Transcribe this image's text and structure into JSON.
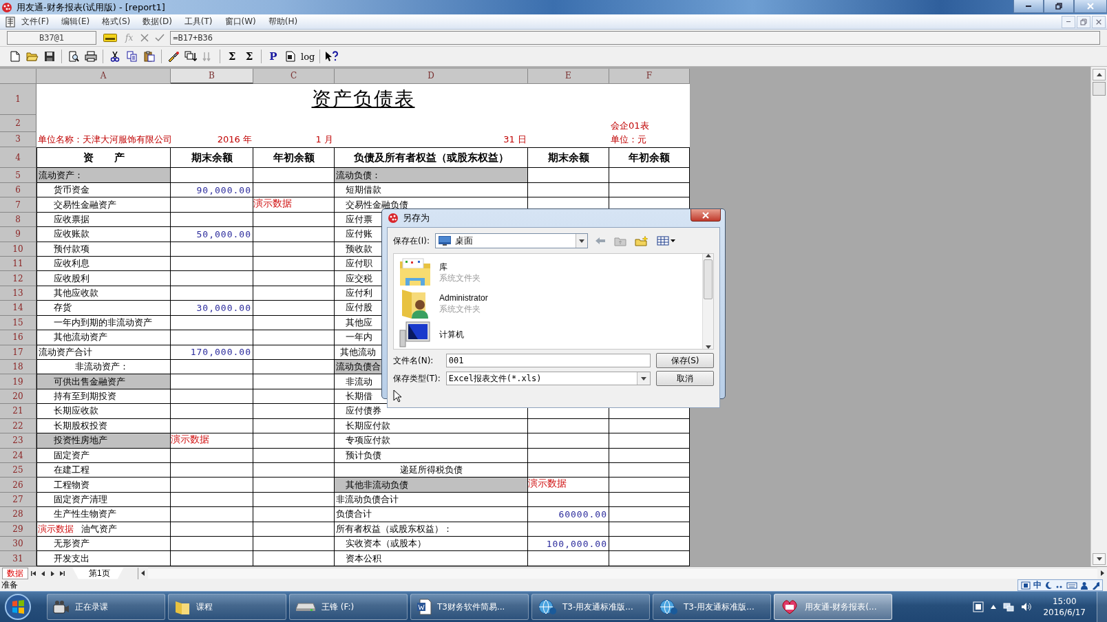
{
  "window": {
    "title": "用友通-财务报表(试用版) - [report1]"
  },
  "menu": [
    "文件(F)",
    "编辑(E)",
    "格式(S)",
    "数据(D)",
    "工具(T)",
    "窗口(W)",
    "帮助(H)"
  ],
  "formula_bar": {
    "cell_ref": "B37@1",
    "function_glyph": "fx",
    "formula": "=B17+B36"
  },
  "toolbar": {
    "glyphs": [
      "Σ",
      "Σ",
      "P",
      "log"
    ]
  },
  "sheet": {
    "columns": [
      {
        "label": "A",
        "selected": false
      },
      {
        "label": "B",
        "selected": true
      },
      {
        "label": "C",
        "selected": false
      },
      {
        "label": "D",
        "selected": false
      },
      {
        "label": "E",
        "selected": false
      },
      {
        "label": "F",
        "selected": false
      }
    ],
    "title_row": {
      "number": "1",
      "text": "资产负债表"
    },
    "code_row": {
      "number": "2",
      "text": "会企01表"
    },
    "info_row": {
      "number": "3",
      "company": "单位名称：天津大河服饰有限公司",
      "year": "2016 年",
      "month": "1 月",
      "day": "31 日",
      "unit": "单位：元"
    },
    "header_row": {
      "number": "4",
      "cells": [
        "资　　产",
        "期末余额",
        "年初余额",
        "负债及所有者权益（或股东权益）",
        "期末余额",
        "年初余额"
      ]
    },
    "rows": [
      {
        "number": "5",
        "a": {
          "text": "流动资产：",
          "kind": "heading",
          "shaded": true
        },
        "d": {
          "text": "流动负债：",
          "kind": "heading",
          "shaded": true
        }
      },
      {
        "number": "6",
        "a": {
          "text": "货币资金",
          "kind": "item",
          "shaded": false
        },
        "b": {
          "text": "90,000.00",
          "kind": "amount",
          "shaded": false
        },
        "d": {
          "text": "短期借款",
          "kind": "item",
          "shaded": false
        }
      },
      {
        "number": "7",
        "a": {
          "text": "交易性金融资产",
          "kind": "item",
          "shaded": false
        },
        "c": {
          "text": "演示数据",
          "kind": "demo",
          "shaded": false
        },
        "d": {
          "text": "交易性金融负债",
          "kind": "item",
          "shaded": false
        }
      },
      {
        "number": "8",
        "a": {
          "text": "应收票据",
          "kind": "item",
          "shaded": false
        },
        "d": {
          "text": "应付票",
          "kind": "item",
          "shaded": false
        }
      },
      {
        "number": "9",
        "a": {
          "text": "应收账款",
          "kind": "item",
          "shaded": false
        },
        "b": {
          "text": "50,000.00",
          "kind": "amount",
          "shaded": false
        },
        "d": {
          "text": "应付账",
          "kind": "item",
          "shaded": false
        }
      },
      {
        "number": "10",
        "a": {
          "text": "预付款项",
          "kind": "item",
          "shaded": false
        },
        "d": {
          "text": "预收款",
          "kind": "item",
          "shaded": false
        }
      },
      {
        "number": "11",
        "a": {
          "text": "应收利息",
          "kind": "item",
          "shaded": false
        },
        "d": {
          "text": "应付职",
          "kind": "item",
          "shaded": false
        }
      },
      {
        "number": "12",
        "a": {
          "text": "应收股利",
          "kind": "item",
          "shaded": false
        },
        "d": {
          "text": "应交税",
          "kind": "item",
          "shaded": false
        }
      },
      {
        "number": "13",
        "a": {
          "text": "其他应收款",
          "kind": "item",
          "shaded": false
        },
        "d": {
          "text": "应付利",
          "kind": "item",
          "shaded": false
        }
      },
      {
        "number": "14",
        "a": {
          "text": "存货",
          "kind": "item",
          "shaded": false
        },
        "b": {
          "text": "30,000.00",
          "kind": "amount",
          "shaded": false
        },
        "d": {
          "text": "应付股",
          "kind": "item",
          "shaded": false
        }
      },
      {
        "number": "15",
        "a": {
          "text": "一年内到期的非流动资产",
          "kind": "item",
          "shaded": false
        },
        "d": {
          "text": "其他应",
          "kind": "item",
          "shaded": false
        }
      },
      {
        "number": "16",
        "a": {
          "text": "其他流动资产",
          "kind": "item",
          "shaded": false
        },
        "d": {
          "text": "一年内",
          "kind": "item",
          "shaded": false
        }
      },
      {
        "number": "17",
        "a": {
          "text": "流动资产合计",
          "kind": "heading",
          "shaded": false
        },
        "b": {
          "text": "170,000.00",
          "kind": "amount",
          "shaded": false
        },
        "d": {
          "text": "其他流动",
          "kind": "minor",
          "shaded": false
        }
      },
      {
        "number": "18",
        "a": {
          "text": "非流动资产：",
          "kind": "sub",
          "shaded": false
        },
        "d": {
          "text": "流动负债合",
          "kind": "heading",
          "shaded": true
        }
      },
      {
        "number": "19",
        "a": {
          "text": "可供出售金融资产",
          "kind": "item",
          "shaded": true
        },
        "d": {
          "text": "非流动",
          "kind": "item",
          "shaded": false
        }
      },
      {
        "number": "20",
        "a": {
          "text": "持有至到期投资",
          "kind": "item",
          "shaded": false
        },
        "d": {
          "text": "长期借",
          "kind": "item",
          "shaded": false
        }
      },
      {
        "number": "21",
        "a": {
          "text": "长期应收款",
          "kind": "item",
          "shaded": false
        },
        "d": {
          "text": "应付债券",
          "kind": "item",
          "shaded": false
        }
      },
      {
        "number": "22",
        "a": {
          "text": "长期股权投资",
          "kind": "item",
          "shaded": false
        },
        "d": {
          "text": "长期应付款",
          "kind": "item",
          "shaded": false
        }
      },
      {
        "number": "23",
        "a": {
          "text": "投资性房地产",
          "kind": "item",
          "shaded": true
        },
        "b": {
          "text": "演示数据",
          "kind": "demo",
          "shaded": false
        },
        "d": {
          "text": "专项应付款",
          "kind": "item",
          "shaded": false
        }
      },
      {
        "number": "24",
        "a": {
          "text": "固定资产",
          "kind": "item",
          "shaded": false
        },
        "d": {
          "text": "预计负债",
          "kind": "item",
          "shaded": false
        }
      },
      {
        "number": "25",
        "a": {
          "text": "在建工程",
          "kind": "item",
          "shaded": false
        },
        "d": {
          "text": "递延所得税负债",
          "kind": "center",
          "shaded": false
        }
      },
      {
        "number": "26",
        "a": {
          "text": "工程物资",
          "kind": "item",
          "shaded": false
        },
        "d": {
          "text": "其他非流动负债",
          "kind": "item",
          "shaded": true
        },
        "e": {
          "text": "演示数据",
          "kind": "demo",
          "shaded": false
        }
      },
      {
        "number": "27",
        "a": {
          "text": "固定资产清理",
          "kind": "item",
          "shaded": false
        },
        "d": {
          "text": "非流动负债合计",
          "kind": "heading",
          "shaded": false
        }
      },
      {
        "number": "28",
        "a": {
          "text": "生产性生物资产",
          "kind": "item",
          "shaded": false
        },
        "d": {
          "text": "负债合计",
          "kind": "heading",
          "shaded": false
        },
        "e": {
          "text": "60000.00",
          "kind": "amount",
          "shaded": false
        }
      },
      {
        "number": "29",
        "a": {
          "text": "油气资产",
          "kind": "item",
          "shaded": false,
          "mark": "演示数据"
        },
        "d": {
          "text": "所有者权益（或股东权益）：",
          "kind": "heading",
          "shaded": false
        }
      },
      {
        "number": "30",
        "a": {
          "text": "无形资产",
          "kind": "item",
          "shaded": false
        },
        "d": {
          "text": "实收资本（或股本）",
          "kind": "item",
          "shaded": false
        },
        "e": {
          "text": "100,000.00",
          "kind": "amount",
          "shaded": false
        }
      },
      {
        "number": "31",
        "a": {
          "text": "开发支出",
          "kind": "item",
          "shaded": false
        },
        "d": {
          "text": "资本公积",
          "kind": "item",
          "shaded": false
        }
      }
    ]
  },
  "sheet_tabs": {
    "mode": "数据",
    "tabs": [
      {
        "label": "第1页",
        "selected": true
      }
    ]
  },
  "status_bar": {
    "text": "准备",
    "ime": "中"
  },
  "dialog": {
    "title": "另存为",
    "save_in_label": "保存在(I):",
    "save_in_value": "桌面",
    "files": [
      {
        "name": "库",
        "type": "系统文件夹",
        "kind": "library"
      },
      {
        "name": "Administrator",
        "type": "系统文件夹",
        "kind": "user"
      },
      {
        "name": "计算机",
        "kind": "computer"
      }
    ],
    "filename_label": "文件名(N):",
    "filename": "001",
    "filetype_label": "保存类型(T):",
    "filetype": "Excel报表文件(*.xls)",
    "buttons": [
      "保存(S)",
      "取消"
    ]
  },
  "taskbar": {
    "items": [
      {
        "label": "正在录课",
        "kind": "recorder",
        "selected": false
      },
      {
        "label": "课程",
        "kind": "folder",
        "selected": false
      },
      {
        "label": "王锋 (F:)",
        "kind": "drive",
        "selected": false
      },
      {
        "label": "T3财务软件简易...",
        "kind": "document",
        "selected": false
      },
      {
        "label": "T3-用友通标准版...",
        "kind": "app",
        "selected": false
      },
      {
        "label": "T3-用友通标准版...",
        "kind": "app",
        "selected": false
      },
      {
        "label": "用友通-财务报表(...",
        "kind": "report",
        "selected": true
      }
    ],
    "time": "15:00",
    "date": "2016/6/17"
  }
}
